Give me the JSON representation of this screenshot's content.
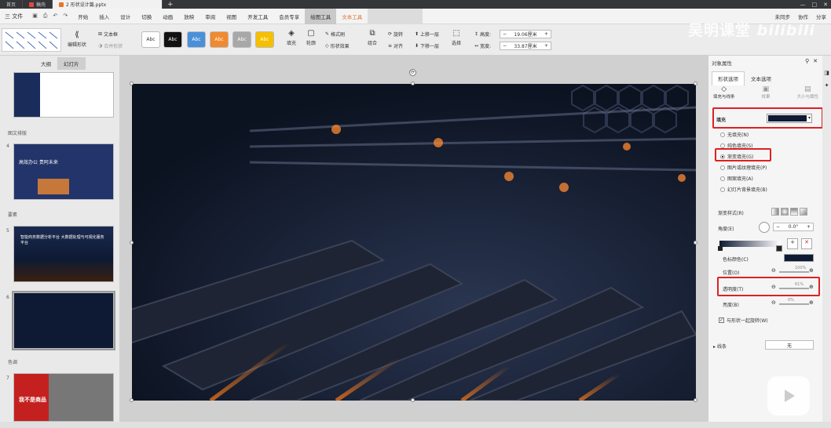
{
  "tabs": [
    {
      "label": "首页"
    },
    {
      "label": "稿壳"
    },
    {
      "label": "2 形状设计篇.pptx"
    }
  ],
  "tab_plus": "+",
  "window_controls": {
    "minimize": "—",
    "maximize": "□",
    "close": "✕"
  },
  "menu": {
    "file": "三 文件",
    "items": [
      "开始",
      "插入",
      "设计",
      "切换",
      "动画",
      "放映",
      "审阅",
      "视图",
      "开发工具",
      "会员专享",
      "绘图工具",
      "文本工具"
    ],
    "right": [
      "未同步",
      "协作",
      "分享"
    ]
  },
  "ribbon": {
    "edit_shape": "编辑形状",
    "textbox": "文本框",
    "merge_shape": "合并形状",
    "styles": [
      "Abc",
      "Abc",
      "Abc",
      "Abc",
      "Abc",
      "Abc"
    ],
    "fill": "填充",
    "outline": "轮廓",
    "format_brush": "格式刷",
    "shape_effect": "形状效果",
    "combine": "组合",
    "rotate": "旋转",
    "align": "对齐",
    "bring_forward": "上移一层",
    "send_backward": "下移一层",
    "select": "选择",
    "height_label": "高度:",
    "height_value": "19.06厘米",
    "width_label": "宽度:",
    "width_value": "33.87厘米"
  },
  "left_panel": {
    "tabs": [
      "大纲",
      "幻灯片"
    ],
    "sections": [
      "图文排版",
      "要素",
      "色调"
    ],
    "slide_numbers": [
      "4",
      "5",
      "6",
      "7"
    ],
    "slide4_text": "高效办公 贵阿未来",
    "slide5_text": "智能商务数据分析平台 大数据处理与可视化服务平台",
    "slide7_text": "我不是商品"
  },
  "right_panel": {
    "title": "对象属性",
    "tabs": [
      "形状选项",
      "文本选项"
    ],
    "subtabs": [
      "填充与线条",
      "效果",
      "大小与属性"
    ],
    "fill_label": "填充",
    "fill_color": "#0e1a33",
    "options": [
      "无填充(N)",
      "纯色填充(S)",
      "渐变填充(G)",
      "图片或纹理填充(P)",
      "图案填充(A)",
      "幻灯片背景填充(B)"
    ],
    "gradient_style_label": "渐变样式(R)",
    "angle_label": "角度(E)",
    "angle_value": "0.0°",
    "stop_color_label": "色标颜色(C)",
    "position_label": "位置(O)",
    "position_value": "100%",
    "transparency_label": "透明度(T)",
    "transparency_value": "61%",
    "brightness_label": "亮度(B)",
    "brightness_value": "0%",
    "rotate_with_shape": "与形状一起旋转(W)",
    "line_label": "线条",
    "line_value": "无"
  },
  "watermark": "吴明课堂",
  "watermark_brand": "bilibili"
}
